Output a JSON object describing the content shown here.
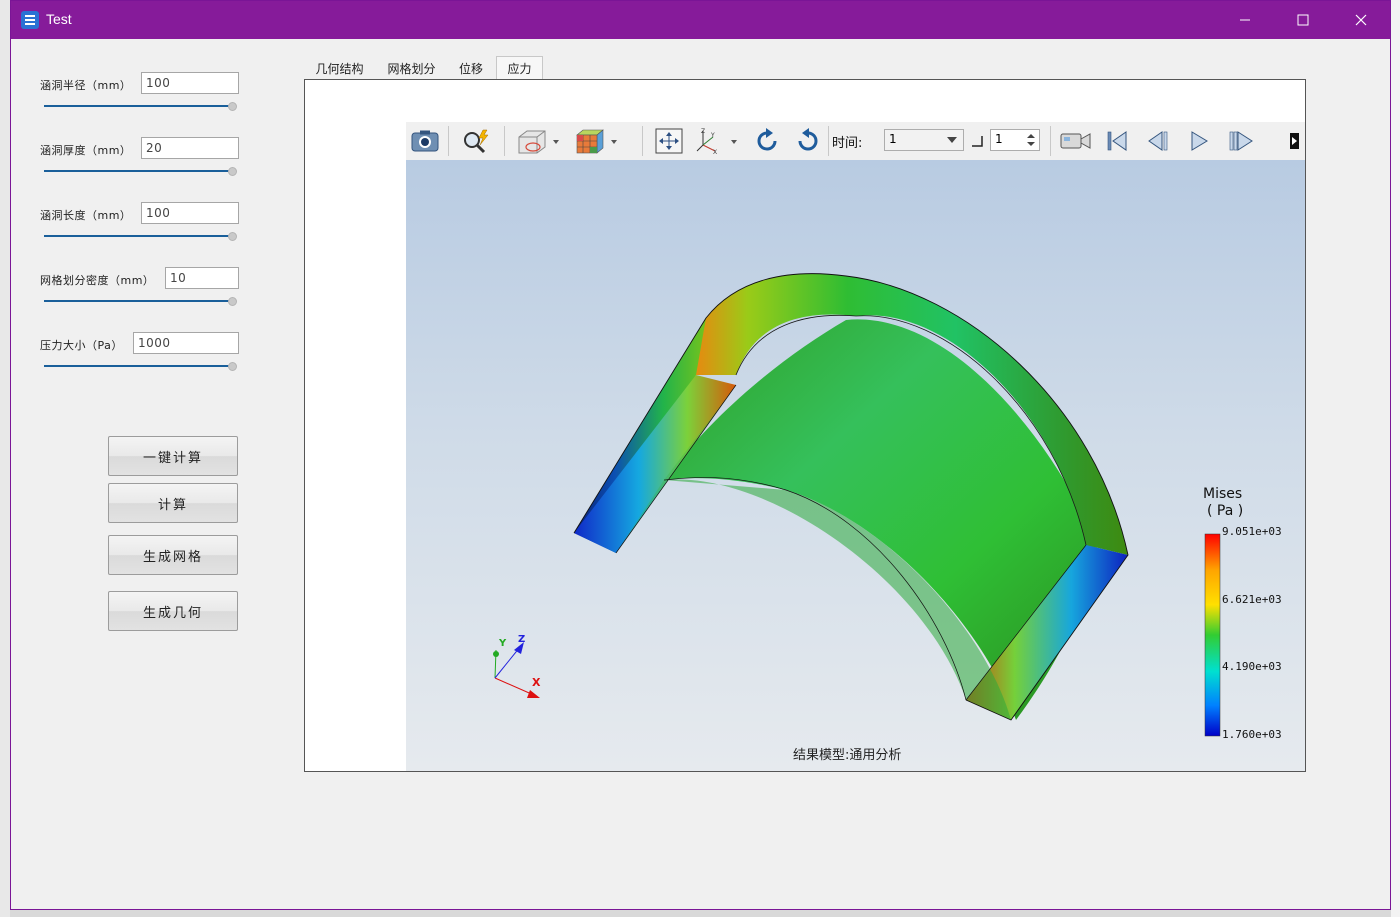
{
  "window": {
    "title": "Test"
  },
  "params": [
    {
      "label": "涵洞半径（mm）",
      "value": "100"
    },
    {
      "label": "涵洞厚度（mm）",
      "value": "20"
    },
    {
      "label": "涵洞长度（mm）",
      "value": "100"
    },
    {
      "label": "网格划分密度（mm）",
      "value": "10"
    },
    {
      "label": "压力大小（Pa）",
      "value": "1000"
    }
  ],
  "buttons": {
    "one_click": "一键计算",
    "compute": "计算",
    "gen_mesh": "生成网格",
    "gen_geom": "生成几何"
  },
  "tabs": [
    {
      "label": "几何结构",
      "active": false
    },
    {
      "label": "网格划分",
      "active": false
    },
    {
      "label": "位移",
      "active": false
    },
    {
      "label": "应力",
      "active": true
    }
  ],
  "toolbar": {
    "time_label": "时间:",
    "time_value": "1",
    "step_value": "1"
  },
  "legend": {
    "title": "Mises",
    "unit": "( Pa )",
    "ticks": [
      "9.051e+03",
      "6.621e+03",
      "4.190e+03",
      "1.760e+03"
    ]
  },
  "axes": {
    "x": "X",
    "y": "Y",
    "z": "Z"
  },
  "viewport": {
    "caption": "结果模型:通用分析"
  },
  "colors": {
    "titlebar": "#861b9a",
    "accent": "#1a5f9a"
  }
}
